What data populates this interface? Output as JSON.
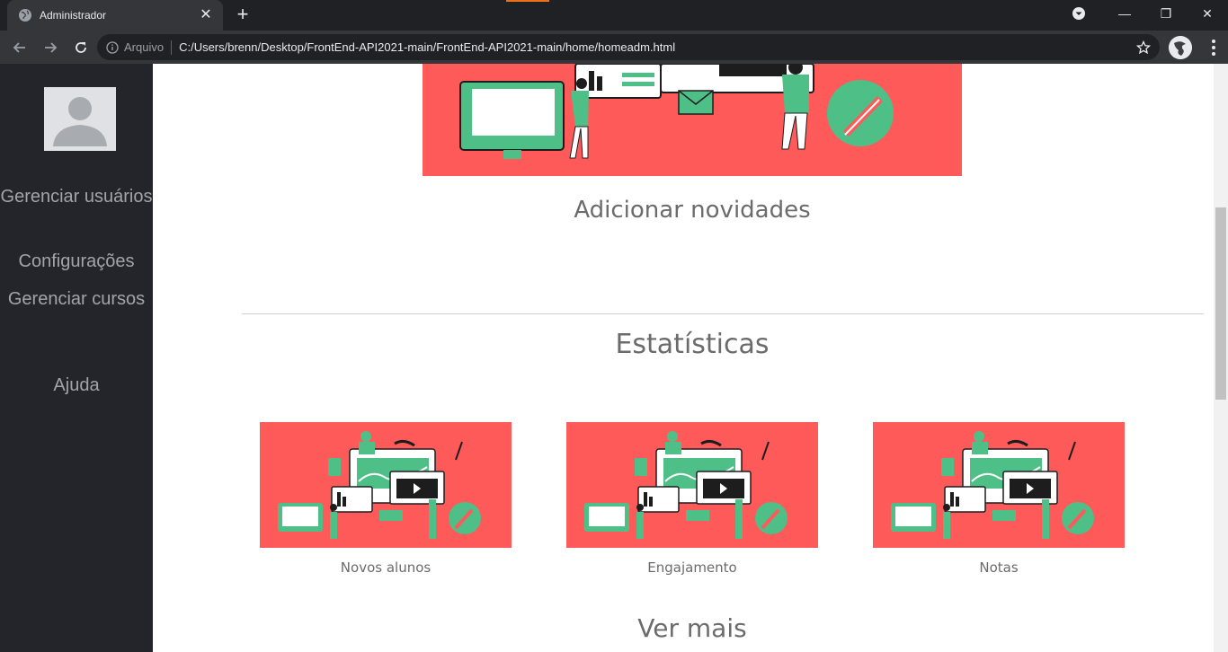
{
  "browser": {
    "tab_title": "Administrador",
    "new_tab": "+",
    "scheme_label": "Arquivo",
    "url": "C:/Users/brenn/Desktop/FrontEnd-API2021-main/FrontEnd-API2021-main/home/homeadm.html",
    "window_controls": {
      "minimize": "—",
      "restore": "❐",
      "close": "✕"
    },
    "tab_close": "✕"
  },
  "sidebar": {
    "items": [
      {
        "label": "Gerenciar usuários"
      },
      {
        "label": "Configurações"
      },
      {
        "label": "Gerenciar cursos"
      },
      {
        "label": "Ajuda"
      }
    ]
  },
  "main": {
    "section_news_title": "Adicionar novidades",
    "section_stats_title": "Estatísticas",
    "cards": [
      {
        "caption": "Novos alunos"
      },
      {
        "caption": "Engajamento"
      },
      {
        "caption": "Notas"
      }
    ],
    "more_title": "Ver mais"
  },
  "colors": {
    "illustration_bg": "#ff5a5a",
    "illustration_accent": "#4ebf87",
    "sidebar_bg": "#24252a",
    "text_muted": "#6b6b6b"
  }
}
